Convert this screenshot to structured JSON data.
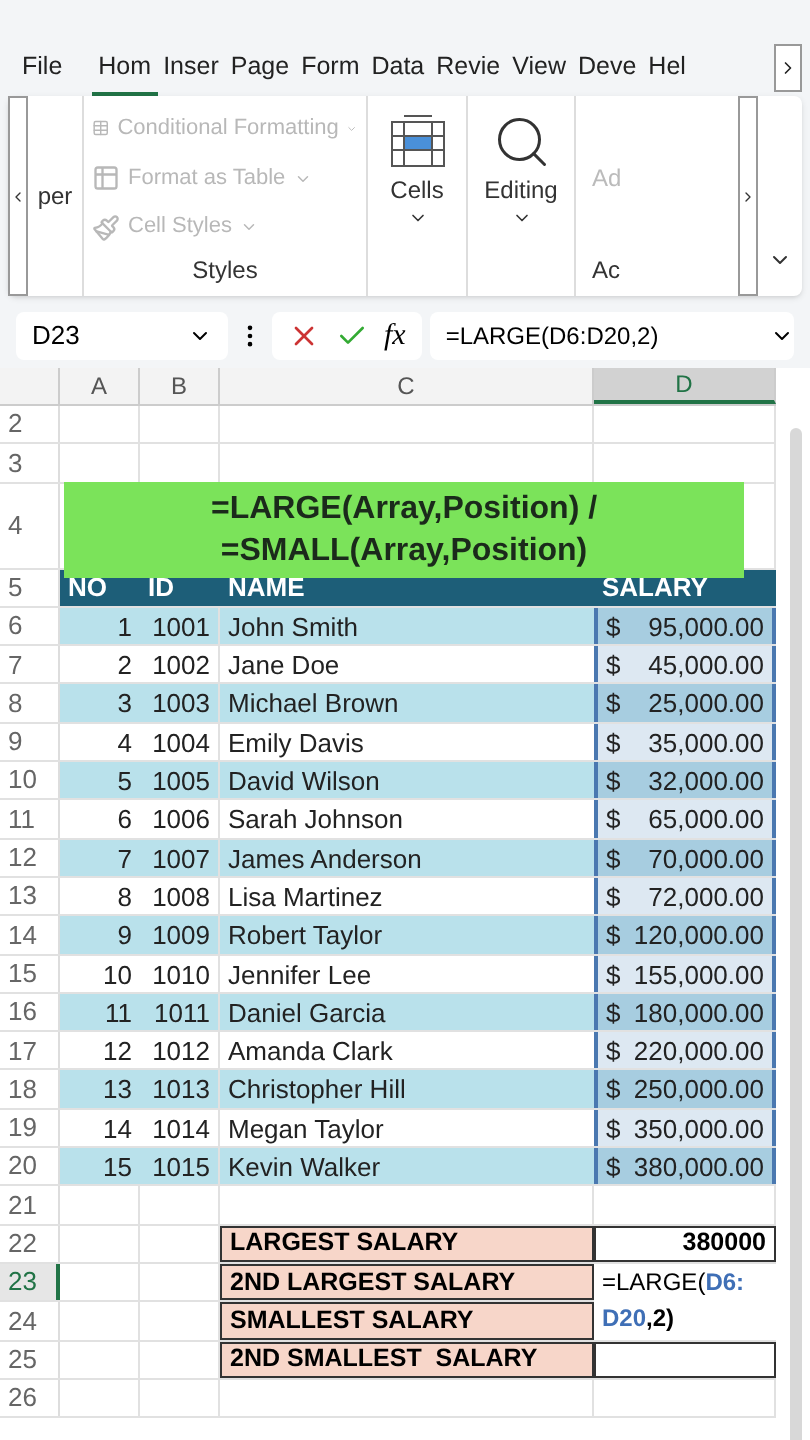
{
  "tabs": [
    {
      "label": "File",
      "selected": false
    },
    {
      "label": "Hom",
      "selected": true
    },
    {
      "label": "Inser",
      "selected": false
    },
    {
      "label": "Page",
      "selected": false
    },
    {
      "label": "Form",
      "selected": false
    },
    {
      "label": "Data",
      "selected": false
    },
    {
      "label": "Revie",
      "selected": false
    },
    {
      "label": "View",
      "selected": false
    },
    {
      "label": "Deve",
      "selected": false
    },
    {
      "label": "Hel",
      "selected": false
    }
  ],
  "ribbon": {
    "left_fragment": "per",
    "style_commands": [
      {
        "label": "Conditional Formatting",
        "disabled": true
      },
      {
        "label": "Format as Table",
        "disabled": true
      },
      {
        "label": "Cell Styles",
        "disabled": true
      }
    ],
    "styles_group": "Styles",
    "cells": "Cells",
    "editing": "Editing",
    "right_fragment": "Ad",
    "right_group_fragment": "Ac"
  },
  "formula_bar": {
    "name_box": "D23",
    "fx": "fx",
    "formula": "=LARGE(D6:D20,2)"
  },
  "sheet": {
    "columns": [
      {
        "label": "A",
        "selected": false
      },
      {
        "label": "B",
        "selected": false
      },
      {
        "label": "C",
        "selected": false
      },
      {
        "label": "D",
        "selected": true
      }
    ],
    "banner": [
      "=LARGE(Array,Position) /",
      "=SMALL(Array,Position)"
    ],
    "rows": [
      {
        "kind": "blank",
        "num": "2"
      },
      {
        "kind": "blank",
        "num": "3"
      },
      {
        "kind": "banner",
        "num": "4"
      },
      {
        "kind": "header",
        "num": "5",
        "cells": [
          "NO",
          "ID",
          "NAME",
          "SALARY"
        ]
      },
      {
        "kind": "data",
        "num": "6",
        "no": "1",
        "id": "1001",
        "name": "John Smith",
        "currency": "$",
        "amount": "95,000.00"
      },
      {
        "kind": "data",
        "num": "7",
        "no": "2",
        "id": "1002",
        "name": "Jane Doe",
        "currency": "$",
        "amount": "45,000.00"
      },
      {
        "kind": "data",
        "num": "8",
        "no": "3",
        "id": "1003",
        "name": "Michael Brown",
        "currency": "$",
        "amount": "25,000.00"
      },
      {
        "kind": "data",
        "num": "9",
        "no": "4",
        "id": "1004",
        "name": "Emily Davis",
        "currency": "$",
        "amount": "35,000.00"
      },
      {
        "kind": "data",
        "num": "10",
        "no": "5",
        "id": "1005",
        "name": "David Wilson",
        "currency": "$",
        "amount": "32,000.00"
      },
      {
        "kind": "data",
        "num": "11",
        "no": "6",
        "id": "1006",
        "name": "Sarah Johnson",
        "currency": "$",
        "amount": "65,000.00"
      },
      {
        "kind": "data",
        "num": "12",
        "no": "7",
        "id": "1007",
        "name": "James Anderson",
        "currency": "$",
        "amount": "70,000.00"
      },
      {
        "kind": "data",
        "num": "13",
        "no": "8",
        "id": "1008",
        "name": "Lisa Martinez",
        "currency": "$",
        "amount": "72,000.00"
      },
      {
        "kind": "data",
        "num": "14",
        "no": "9",
        "id": "1009",
        "name": "Robert Taylor",
        "currency": "$",
        "amount": "120,000.00"
      },
      {
        "kind": "data",
        "num": "15",
        "no": "10",
        "id": "1010",
        "name": "Jennifer Lee",
        "currency": "$",
        "amount": "155,000.00"
      },
      {
        "kind": "data",
        "num": "16",
        "no": "11",
        "id": "1011",
        "name": "Daniel Garcia",
        "currency": "$",
        "amount": "180,000.00"
      },
      {
        "kind": "data",
        "num": "17",
        "no": "12",
        "id": "1012",
        "name": "Amanda Clark",
        "currency": "$",
        "amount": "220,000.00"
      },
      {
        "kind": "data",
        "num": "18",
        "no": "13",
        "id": "1013",
        "name": "Christopher Hill",
        "currency": "$",
        "amount": "250,000.00"
      },
      {
        "kind": "data",
        "num": "19",
        "no": "14",
        "id": "1014",
        "name": "Megan Taylor",
        "currency": "$",
        "amount": "350,000.00"
      },
      {
        "kind": "data",
        "num": "20",
        "no": "15",
        "id": "1015",
        "name": "Kevin Walker",
        "currency": "$",
        "amount": "380,000.00"
      },
      {
        "kind": "blank",
        "num": "21"
      },
      {
        "kind": "summary",
        "num": "22",
        "label": "LARGEST SALARY",
        "value": "380000",
        "active": false
      },
      {
        "kind": "summary",
        "num": "23",
        "label": "2ND LARGEST SALARY",
        "active": true,
        "editor": {
          "before": "=LARGE(",
          "ref": "D6:D20",
          "after": ",2)"
        }
      },
      {
        "kind": "summary",
        "num": "24",
        "label": "SMALLEST SALARY",
        "active": false
      },
      {
        "kind": "summary",
        "num": "25",
        "label": "2ND SMALLEST  SALARY",
        "active": false
      },
      {
        "kind": "blank",
        "num": "26"
      }
    ]
  }
}
